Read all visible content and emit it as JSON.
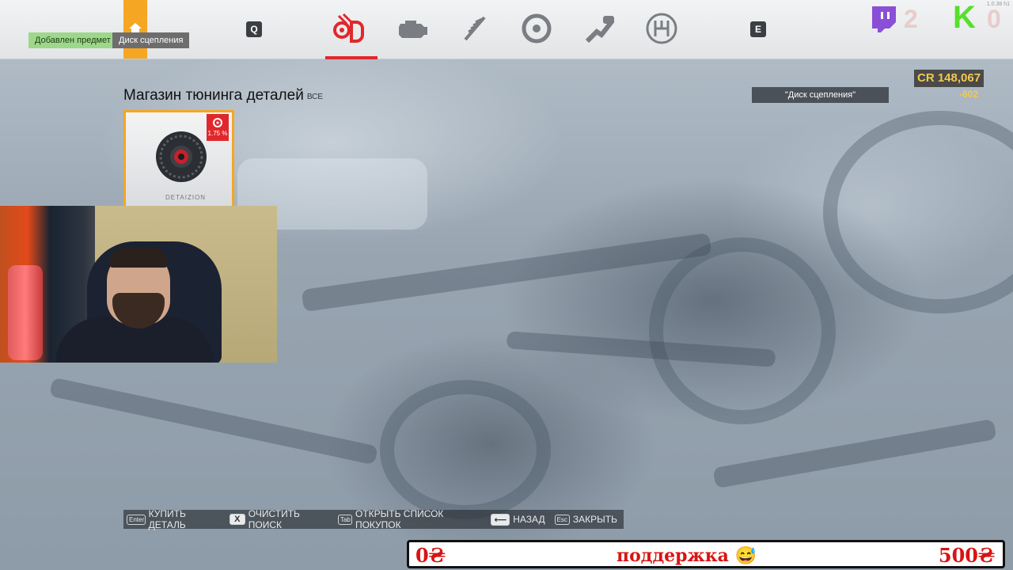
{
  "topbar": {
    "toast_added": "Добавлен предмет",
    "toast_item": "Диск сцепления",
    "key_left": "Q",
    "key_right": "E",
    "categories": [
      "turbo-upgrade-icon",
      "engine-icon",
      "suspension-icon",
      "brake-disc-icon",
      "exhaust-icon",
      "gearshift-icon"
    ],
    "active_category": "turbo-upgrade-icon",
    "accent": "#e0282c",
    "home_color": "#f5a623",
    "twitch_count": "2",
    "k_count": "0",
    "version": "1.0.38 h1"
  },
  "credits": {
    "balance": "CR 148,067",
    "delta": "-602"
  },
  "search": {
    "chip": "\"Диск сцепления\""
  },
  "shop": {
    "title": "Магазин тюнинга деталей",
    "filter": "ВСЕ",
    "items": [
      {
        "name": "clutch-disc",
        "badge": "1.75 %",
        "brand": "DETAIZION"
      }
    ]
  },
  "hints": [
    {
      "key": "Enter",
      "label": "КУПИТЬ ДЕТАЛЬ"
    },
    {
      "key": "X",
      "label": "ОЧИСТИТЬ ПОИСК"
    },
    {
      "key": "Tab",
      "label": "ОТКРЫТЬ СПИСОК ПОКУПОК"
    },
    {
      "key": "⟵",
      "label": "НАЗАД"
    },
    {
      "key": "Esc",
      "label": "ЗАКРЫТЬ"
    }
  ],
  "donation": {
    "low": "0₴",
    "title": "поддержка 😅",
    "high": "500₴"
  }
}
